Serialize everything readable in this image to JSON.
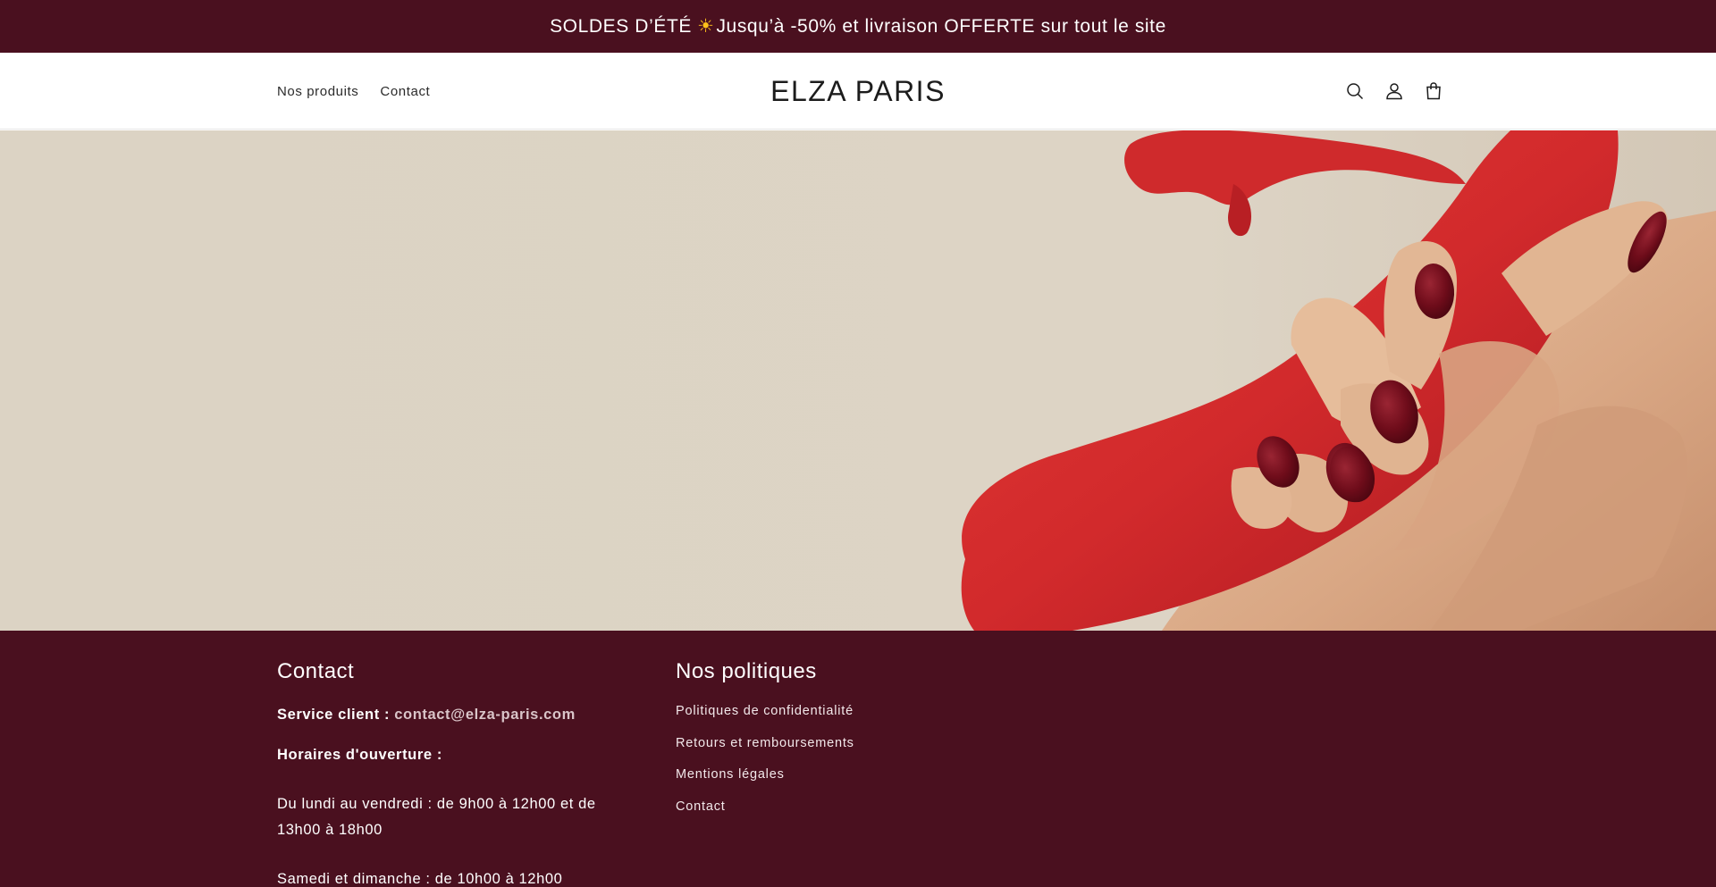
{
  "announcement": {
    "text_before": "SOLDES D’ÉTÉ",
    "sun_glyph": "☀",
    "text_after": "Jusqu’à -50% et livraison OFFERTE sur tout le site"
  },
  "header": {
    "nav": [
      {
        "label": "Nos produits"
      },
      {
        "label": "Contact"
      }
    ],
    "logo": "ELZA PARIS",
    "icons": [
      "search-icon",
      "account-icon",
      "cart-icon"
    ]
  },
  "hero": {
    "image": "hand with dark-red nails holding a red product on beige background"
  },
  "footer": {
    "contact": {
      "heading": "Contact",
      "service_label": "Service client : ",
      "service_email": "contact@elza-paris.com",
      "hours_label": "Horaires d'ouverture :",
      "weekdays": "Du lundi au vendredi : de 9h00 à 12h00 et de 13h00 à 18h00",
      "weekend": "Samedi et dimanche : de 10h00 à 12h00"
    },
    "policies": {
      "heading": "Nos politiques",
      "links": [
        {
          "label": "Politiques de confidentialité"
        },
        {
          "label": "Retours et remboursements"
        },
        {
          "label": "Mentions légales"
        },
        {
          "label": "Contact"
        }
      ]
    }
  },
  "colors": {
    "brand_dark": "#4a101f",
    "hero_bg": "#ddd4c5",
    "product_red": "#d22a2c",
    "nail_red": "#6e0c1a"
  }
}
